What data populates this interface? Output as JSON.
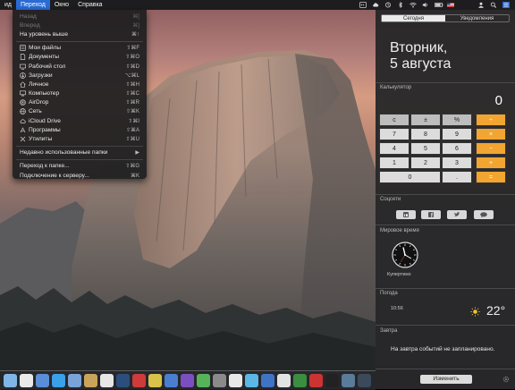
{
  "menubar": {
    "app_partial": "ид",
    "menus": [
      "Переход",
      "Окно",
      "Справка"
    ]
  },
  "go_menu": {
    "items": [
      {
        "label": "Назад",
        "shortcut": "⌘[",
        "dim": true,
        "icon": ""
      },
      {
        "label": "Вперед",
        "shortcut": "⌘]",
        "dim": true,
        "icon": ""
      },
      {
        "label": "На уровень выше",
        "shortcut": "⌘↑",
        "dim": false,
        "icon": ""
      },
      {
        "label": "Мои файлы",
        "shortcut": "⇧⌘F",
        "dim": false,
        "icon": "all-files-icon"
      },
      {
        "label": "Документы",
        "shortcut": "⇧⌘O",
        "dim": false,
        "icon": "documents-icon"
      },
      {
        "label": "Рабочий стол",
        "shortcut": "⇧⌘D",
        "dim": false,
        "icon": "desktop-icon"
      },
      {
        "label": "Загрузки",
        "shortcut": "⌥⌘L",
        "dim": false,
        "icon": "downloads-icon"
      },
      {
        "label": "Личное",
        "shortcut": "⇧⌘H",
        "dim": false,
        "icon": "home-icon"
      },
      {
        "label": "Компьютер",
        "shortcut": "⇧⌘C",
        "dim": false,
        "icon": "computer-icon"
      },
      {
        "label": "AirDrop",
        "shortcut": "⇧⌘R",
        "dim": false,
        "icon": "airdrop-icon"
      },
      {
        "label": "Сеть",
        "shortcut": "⇧⌘K",
        "dim": false,
        "icon": "network-icon"
      },
      {
        "label": "iCloud Drive",
        "shortcut": "⇧⌘I",
        "dim": false,
        "icon": "cloud-icon"
      },
      {
        "label": "Программы",
        "shortcut": "⇧⌘A",
        "dim": false,
        "icon": "applications-icon"
      },
      {
        "label": "Утилиты",
        "shortcut": "⇧⌘U",
        "dim": false,
        "icon": "utilities-icon"
      }
    ],
    "recent_folders": "Недавно использованные папки",
    "go_to_folder": {
      "label": "Переход к папке...",
      "shortcut": "⇧⌘G"
    },
    "connect_server": {
      "label": "Подключение к серверу...",
      "shortcut": "⌘K"
    }
  },
  "notification_center": {
    "tabs": [
      "Сегодня",
      "Уведомления"
    ],
    "date_line1": "Вторник,",
    "date_line2": "5 августа",
    "calculator": {
      "header": "Калькулятор",
      "display": "0",
      "keys": [
        [
          "c",
          "±",
          "%",
          "÷"
        ],
        [
          "7",
          "8",
          "9",
          "×"
        ],
        [
          "4",
          "5",
          "6",
          "−"
        ],
        [
          "1",
          "2",
          "3",
          "+"
        ],
        [
          "0",
          ".",
          "="
        ]
      ]
    },
    "social": {
      "header": "Соцсети",
      "buttons": [
        "linkedin-icon",
        "facebook-icon",
        "twitter-icon",
        "message-icon"
      ]
    },
    "world_clock": {
      "header": "Мировое время",
      "city": "Купертино"
    },
    "weather": {
      "header": "Погода",
      "time": "10:56",
      "temp": "22°"
    },
    "tomorrow": {
      "header": "Завтра",
      "text": "На завтра событий не запланировано."
    },
    "edit_button": "Изменить"
  },
  "colors": {
    "menu_highlight": "#2a6bd6",
    "calc_operator": "#f2a530"
  }
}
